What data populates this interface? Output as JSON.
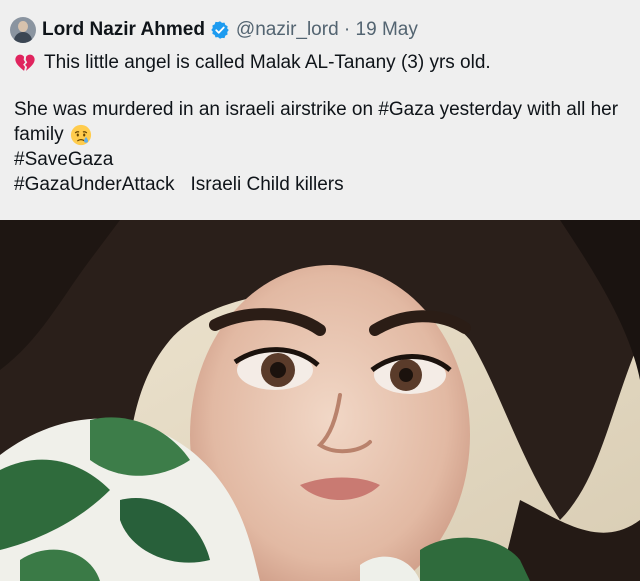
{
  "tweet": {
    "author_name": "Lord Nazir Ahmed",
    "handle_and_date": "@nazir_lord · 19 May",
    "icons": {
      "avatar": "profile-avatar",
      "verified": "verified-badge-icon",
      "line1_emoji": "broken-heart-emoji",
      "line3_emoji": "crying-face-emoji"
    },
    "lines": {
      "line1": "This little angel is called Malak AL-Tanany (3) yrs old.",
      "line2": "She was murdered in an israeli airstrike on #Gaza yesterday with all her",
      "line3": "family",
      "line4": "#SaveGaza",
      "line5_hashtag": "#GazaUnderAttack",
      "line5_text": "Israeli Child killers"
    },
    "colors": {
      "background": "#efefef",
      "verified_blue": "#1d9bf0",
      "handle_gray": "#536471",
      "broken_heart": "#e0245e"
    }
  }
}
